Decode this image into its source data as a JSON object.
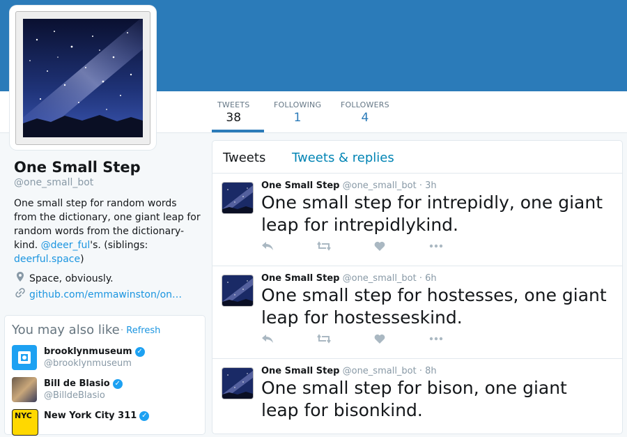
{
  "profile": {
    "name": "One Small Step",
    "handle": "@one_small_bot",
    "bio_prefix": "One small step for random words from the dictionary, one giant leap for random words from the dictionary-kind. ",
    "bio_link1": "@deer_ful",
    "bio_middle": "'s. (siblings: ",
    "bio_link2": "deerful.space",
    "bio_suffix": ")",
    "location": "Space, obviously.",
    "website": "github.com/emmawinston/on…"
  },
  "stats": [
    {
      "label": "TWEETS",
      "value": "38"
    },
    {
      "label": "FOLLOWING",
      "value": "1"
    },
    {
      "label": "FOLLOWERS",
      "value": "4"
    }
  ],
  "tabs": {
    "tweets": "Tweets",
    "replies": "Tweets & replies"
  },
  "tweets": [
    {
      "name": "One Small Step",
      "handle": "@one_small_bot",
      "time": "· 3h",
      "text": "One small step for intrepidly, one giant leap for intrepidlykind."
    },
    {
      "name": "One Small Step",
      "handle": "@one_small_bot",
      "time": "· 6h",
      "text": "One small step for hostesses, one giant leap for hostesseskind."
    },
    {
      "name": "One Small Step",
      "handle": "@one_small_bot",
      "time": "· 8h",
      "text": "One small step for bison, one giant leap for bisonkind."
    }
  ],
  "suggestions": {
    "title": "You may also like",
    "refresh": "Refresh",
    "items": [
      {
        "name": "brooklynmuseum",
        "handle": "@brooklynmuseum"
      },
      {
        "name": "Bill de Blasio",
        "handle": "@BilldeBlasio"
      },
      {
        "name": "New York City 311",
        "handle": "",
        "logo_text": "NYC"
      }
    ]
  },
  "icons": {
    "reply": "reply-icon",
    "retweet": "retweet-icon",
    "like": "heart-icon",
    "more": "more-icon",
    "location": "location-pin-icon",
    "link": "link-icon",
    "verified": "verified-badge-icon"
  },
  "colors": {
    "header": "#2b7bb9",
    "link": "#1b95e0",
    "background": "#f5f8fa"
  }
}
